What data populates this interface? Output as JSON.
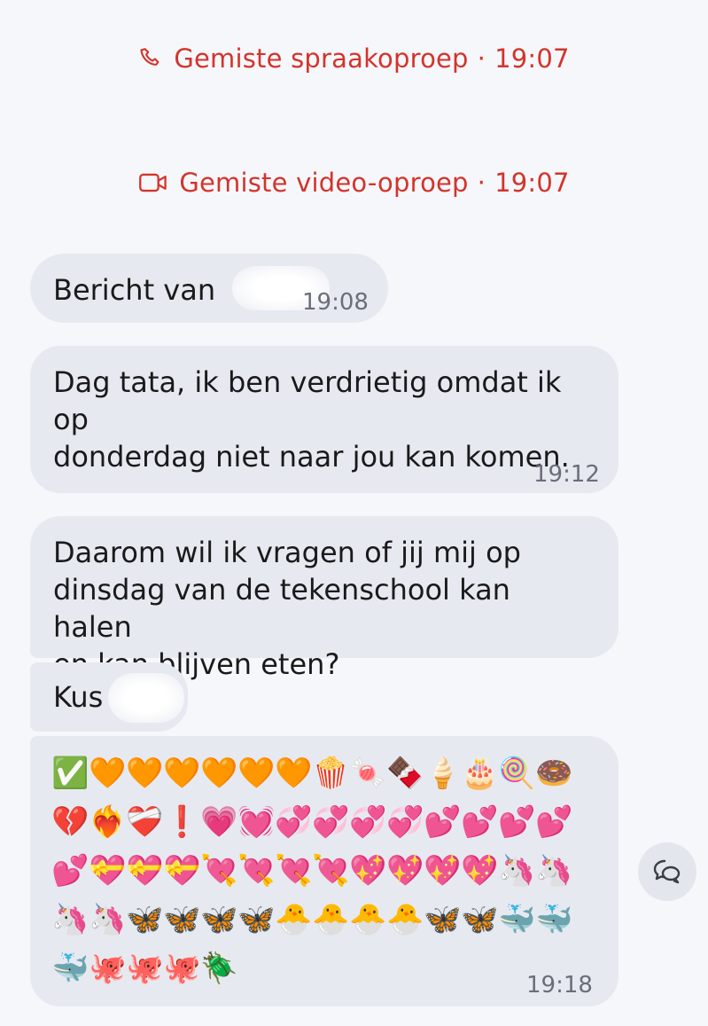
{
  "calls": [
    {
      "label": "Gemiste spraakoproep",
      "separator": "·",
      "time": "19:07",
      "icon": "phone-icon"
    },
    {
      "label": "Gemiste video-oproep",
      "separator": "·",
      "time": "19:07",
      "icon": "video-camera-icon"
    }
  ],
  "messages": [
    {
      "text": "Bericht van",
      "time": "19:08"
    },
    {
      "text": "Dag tata, ik ben verdrietig omdat ik op\ndonderdag niet naar jou kan komen.",
      "time": "19:12"
    },
    {
      "text": "Daarom wil ik vragen of jij mij op\ndinsdag van de tekenschool kan halen\nen kan blijven eten?"
    },
    {
      "text": "Kus"
    },
    {
      "time": "19:18",
      "emoji_rows": [
        [
          "✅",
          "🧡",
          "🧡",
          "🧡",
          "🧡",
          "🧡",
          "🧡",
          "🍿",
          "🍬",
          "🍫",
          "🍦",
          "🎂",
          "🍭",
          "🍩"
        ],
        [
          "💔",
          "❤️‍🔥",
          "❤️‍🩹",
          "❗",
          "💗",
          "💓",
          "💞",
          "💞",
          "💞",
          "💞",
          "💕",
          "💕",
          "💕",
          "💕"
        ],
        [
          "💕",
          "💝",
          "💝",
          "💝",
          "💘",
          "💘",
          "💘",
          "💘",
          "💖",
          "💖",
          "💖",
          "💖",
          "🦄",
          "🦄"
        ],
        [
          "🦄",
          "🦄",
          "🦋",
          "🦋",
          "🦋",
          "🦋",
          "🐣",
          "🐣",
          "🐣",
          "🐣",
          "🦋",
          "🦋",
          "🐳",
          "🐳"
        ],
        [
          "🐳",
          "🐙",
          "🐙",
          "🐙",
          "🪲"
        ]
      ]
    }
  ],
  "colors": {
    "missed_call": "#d3342b",
    "bubble": "#e7e9f1",
    "background": "#f6f7fb"
  },
  "reply_icon": "reply-bubble-icon"
}
